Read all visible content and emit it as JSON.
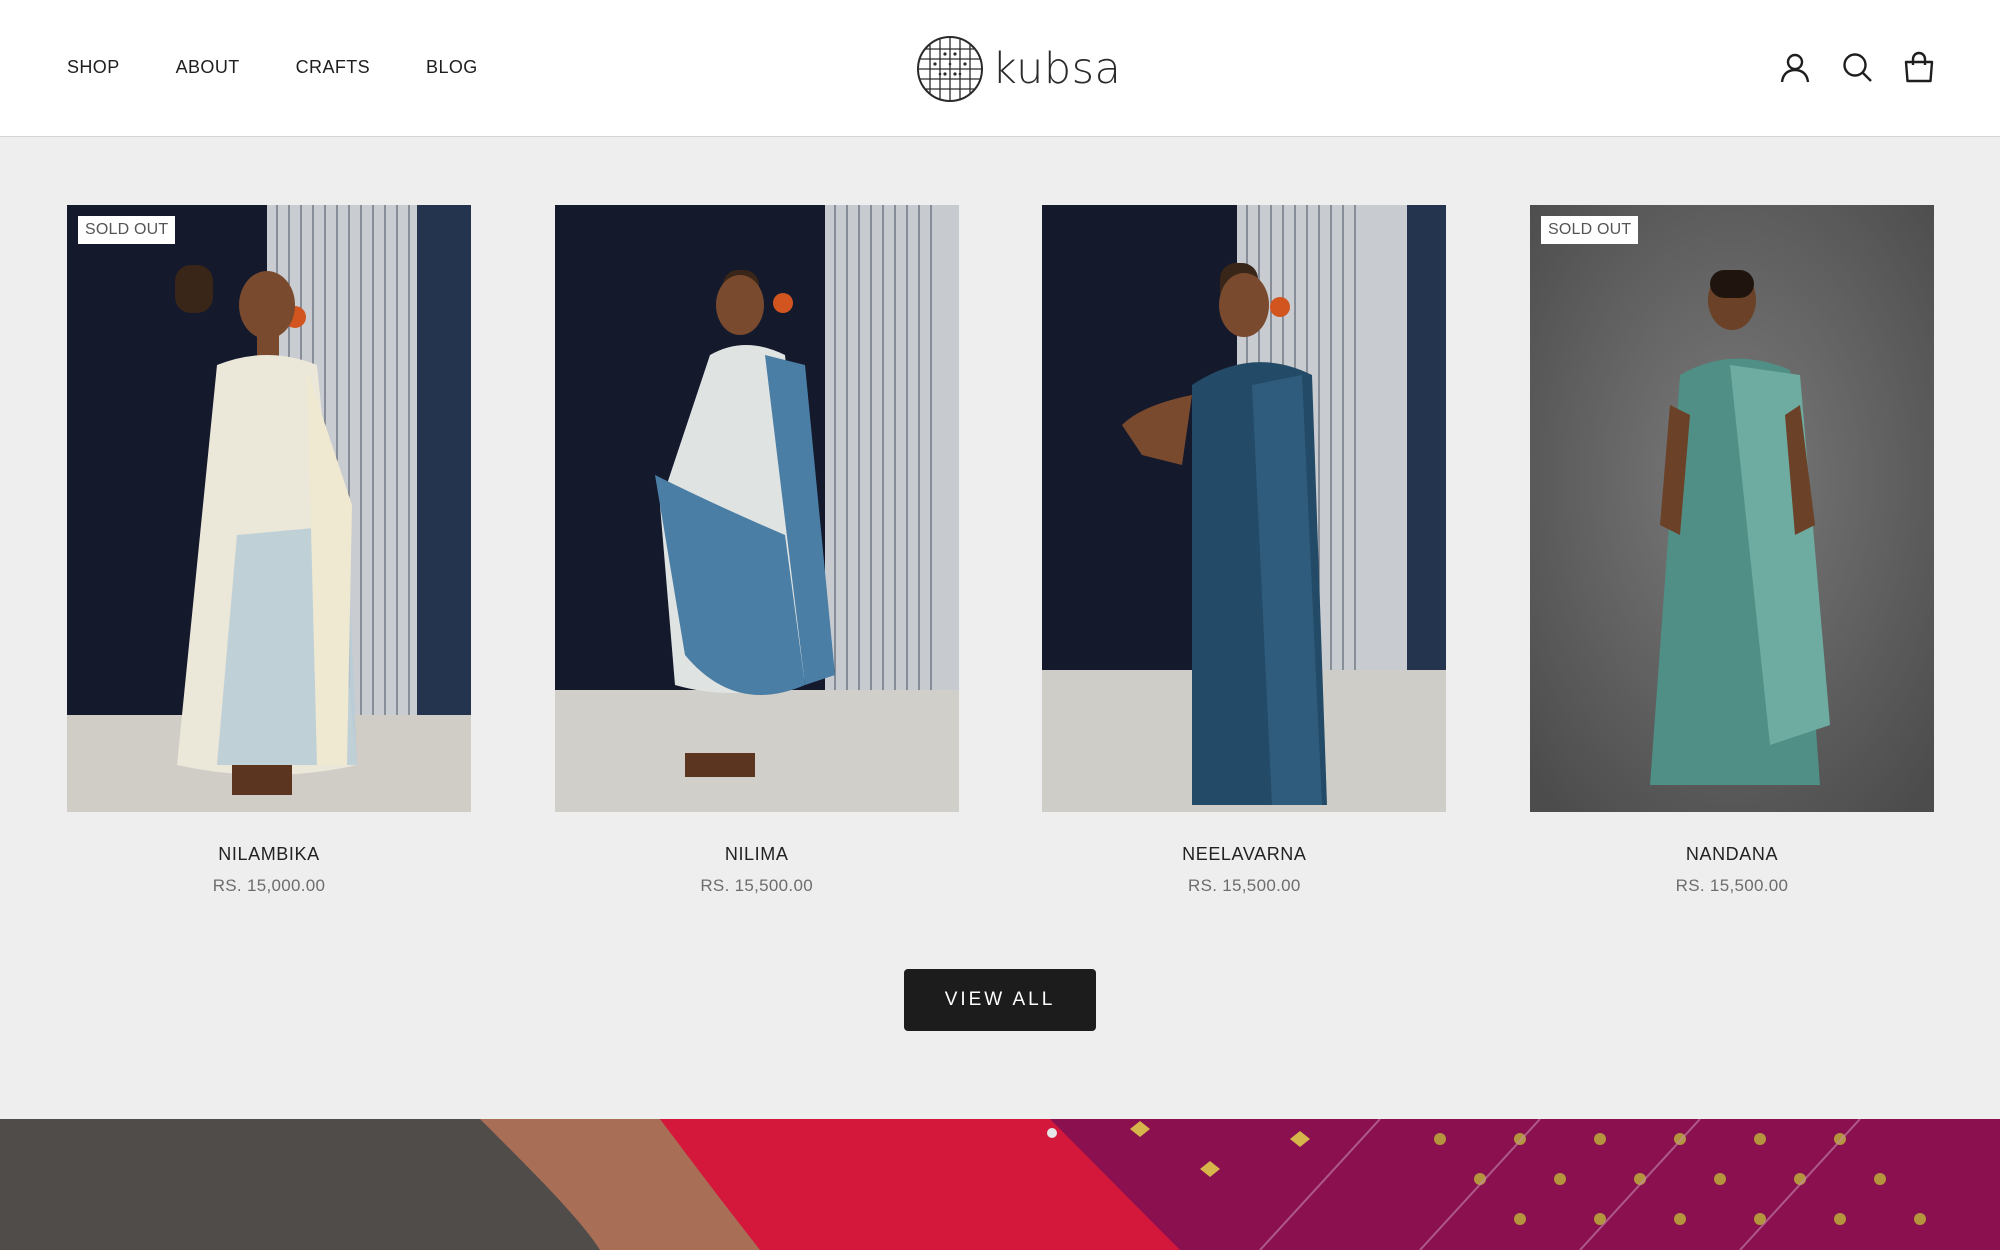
{
  "header": {
    "nav": [
      "SHOP",
      "ABOUT",
      "CRAFTS",
      "BLOG"
    ],
    "logo_text": "kubsa",
    "icons": [
      "account-icon",
      "search-icon",
      "cart-bag-icon"
    ]
  },
  "products": [
    {
      "name": "NILAMBIKA",
      "price": "RS. 15,000.00",
      "badge": "SOLD OUT",
      "saree_color": "#e9e6da",
      "accent": "#a9c3d6"
    },
    {
      "name": "NILIMA",
      "price": "RS. 15,500.00",
      "badge": "",
      "saree_color": "#4a7ea5",
      "accent": "#dfe2e0"
    },
    {
      "name": "NEELAVARNA",
      "price": "RS. 15,500.00",
      "badge": "",
      "saree_color": "#234a66",
      "accent": "#2f6b84"
    },
    {
      "name": "NANDANA",
      "price": "RS. 15,500.00",
      "badge": "SOLD OUT",
      "saree_color": "#4f8f85",
      "accent": "#6eaba0"
    }
  ],
  "view_all_label": "VIEW ALL",
  "colors": {
    "background": "#eeeeee",
    "header_bg": "#ffffff",
    "button_bg": "#1c1c1c",
    "banner_red": "#d4183c",
    "banner_magenta": "#8a1050"
  }
}
